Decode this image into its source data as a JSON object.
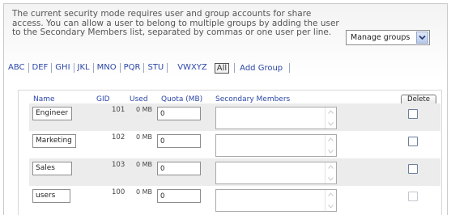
{
  "intro_text": "The current security mode requires user and group accounts for share access. You can allow a user to belong to multiple groups by adding the user to the Secondary Members list, separated by commas or one user per line.",
  "mode_select": {
    "selected": "Manage groups"
  },
  "alpha_nav": {
    "links": [
      "ABC",
      "DEF",
      "GHI",
      "JKL",
      "MNO",
      "PQR",
      "STU",
      "VWXYZ"
    ],
    "all_label": "All",
    "add_group_label": "Add Group"
  },
  "table": {
    "headers": {
      "name": "Name",
      "gid": "GID",
      "used": "Used",
      "quota": "Quota (MB)",
      "secondary": "Secondary Members"
    },
    "delete_label": "Delete",
    "rows": [
      {
        "name": "Engineer",
        "gid": "101",
        "used": "0 MB",
        "quota": "0",
        "members": "",
        "delete_enabled": true
      },
      {
        "name": "Marketing",
        "gid": "102",
        "used": "0 MB",
        "quota": "0",
        "members": "",
        "delete_enabled": true
      },
      {
        "name": "Sales",
        "gid": "103",
        "used": "0 MB",
        "quota": "0",
        "members": "",
        "delete_enabled": true
      },
      {
        "name": "users",
        "gid": "100",
        "used": "0 MB",
        "quota": "0",
        "members": "",
        "delete_enabled": false
      }
    ]
  },
  "colors": {
    "link": "#2b47a7",
    "row_alt": "#ececec"
  }
}
